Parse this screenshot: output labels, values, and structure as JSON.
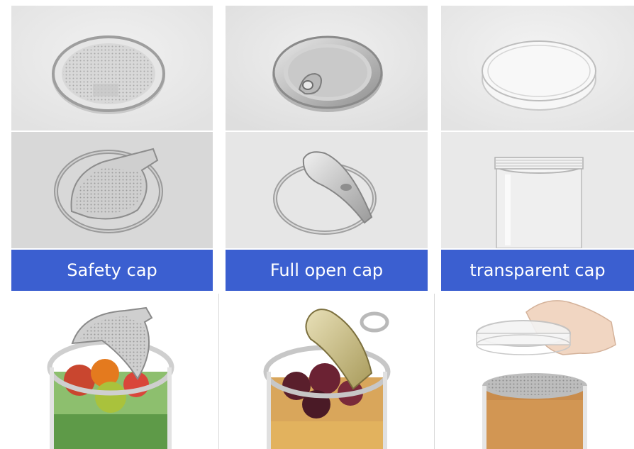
{
  "labels": {
    "safety": "Safety cap",
    "full_open": "Full open cap",
    "transparent": "transparent cap"
  },
  "colors": {
    "label_band": "#3b5fd0",
    "studio_background": "#ebebeb"
  },
  "icons": [
    "safety-cap-closed",
    "safety-cap-open",
    "full-open-cap-closed",
    "full-open-cap-open",
    "transparent-lid",
    "transparent-jar",
    "safety-cap-jar",
    "full-open-cap-jar",
    "transparent-cap-jar-with-hand"
  ]
}
